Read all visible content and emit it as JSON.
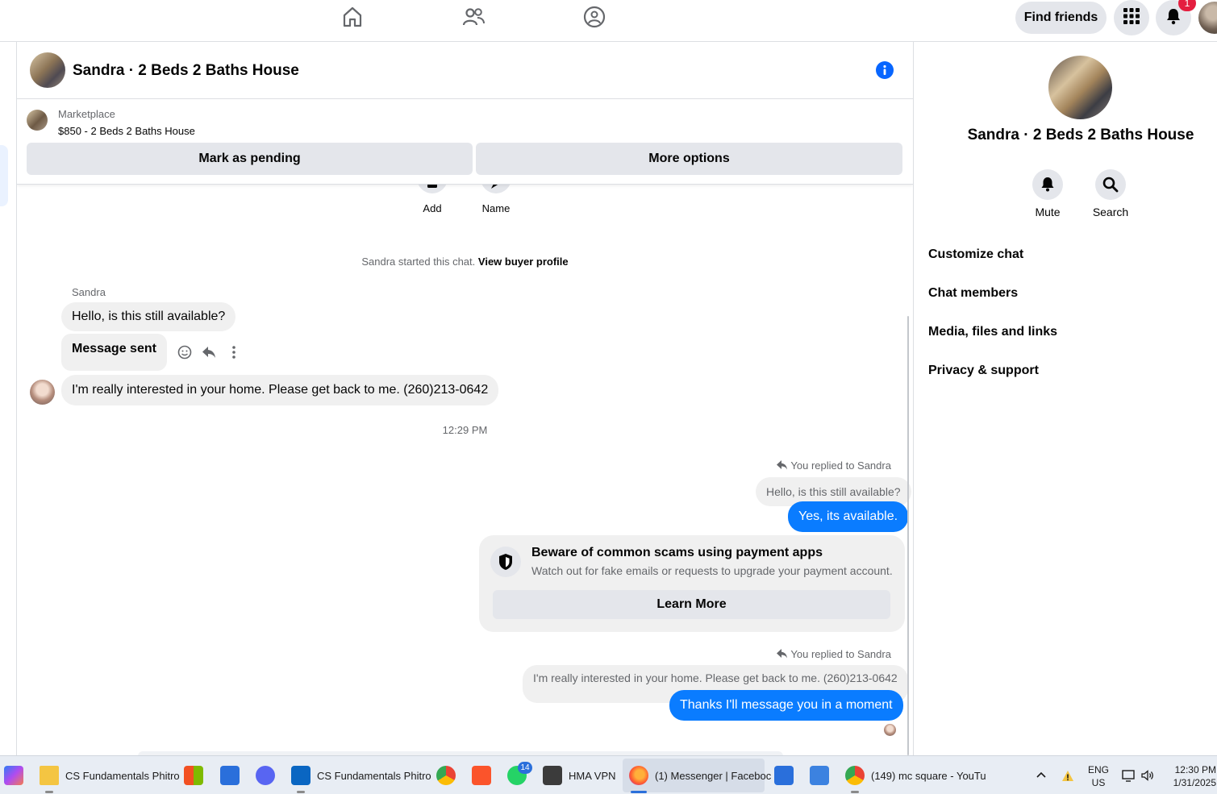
{
  "topnav": {
    "find_friends": "Find friends",
    "notification_count": "1",
    "icons": [
      "home-icon",
      "friends-icon",
      "groups-icon",
      "menu-grid-icon",
      "bell-icon"
    ]
  },
  "chat": {
    "title": "Sandra · 2 Beds 2 Baths House",
    "listing": {
      "source": "Marketplace",
      "item": "$850 - 2 Beds 2 Baths House"
    },
    "actions": {
      "mark_pending": "Mark as pending",
      "more_options": "More options"
    },
    "quick_actions": {
      "add": "Add",
      "name": "Name"
    },
    "started_text": "Sandra started this chat.",
    "view_profile": "View buyer profile",
    "sender_name": "Sandra",
    "messages_in": [
      "Hello, is this still available?",
      "Message sent",
      "I'm really interested in your home. Please get back to me. (260)213-0642"
    ],
    "timestamp": "12:29 PM",
    "reply1": {
      "label": "You replied to Sandra",
      "quoted": "Hello, is this still available?",
      "text": "Yes, its available."
    },
    "scam_card": {
      "title": "Beware of common scams using payment apps",
      "body": "Watch out for fake emails or requests to upgrade your payment account.",
      "button": "Learn More"
    },
    "reply2": {
      "label": "You replied to Sandra",
      "quoted": "I'm really interested in your home. Please get back to me. (260)213-0642",
      "text": "Thanks I'll message you in a moment"
    }
  },
  "rightpanel": {
    "title": "Sandra · 2 Beds 2 Baths House",
    "mute": "Mute",
    "search": "Search",
    "items": [
      "Customize chat",
      "Chat members",
      "Media, files and links",
      "Privacy & support"
    ]
  },
  "taskbar": {
    "apps": [
      {
        "label": "CS Fundamentals Phitro"
      },
      {
        "label": "CS Fundamentals Phitro"
      },
      {
        "label": "HMA VPN"
      },
      {
        "label": "(1) Messenger | Faceboc"
      },
      {
        "label": "(149) mc square - YouTu"
      }
    ],
    "whatsapp_badge": "14",
    "lang": "ENG",
    "region": "US",
    "time": "12:30 PM",
    "date": "1/31/2025"
  },
  "colors": {
    "accent": "#0a7cff",
    "info": "#0866ff",
    "badge": "#e41e3f",
    "grey_button": "#e4e6eb"
  }
}
